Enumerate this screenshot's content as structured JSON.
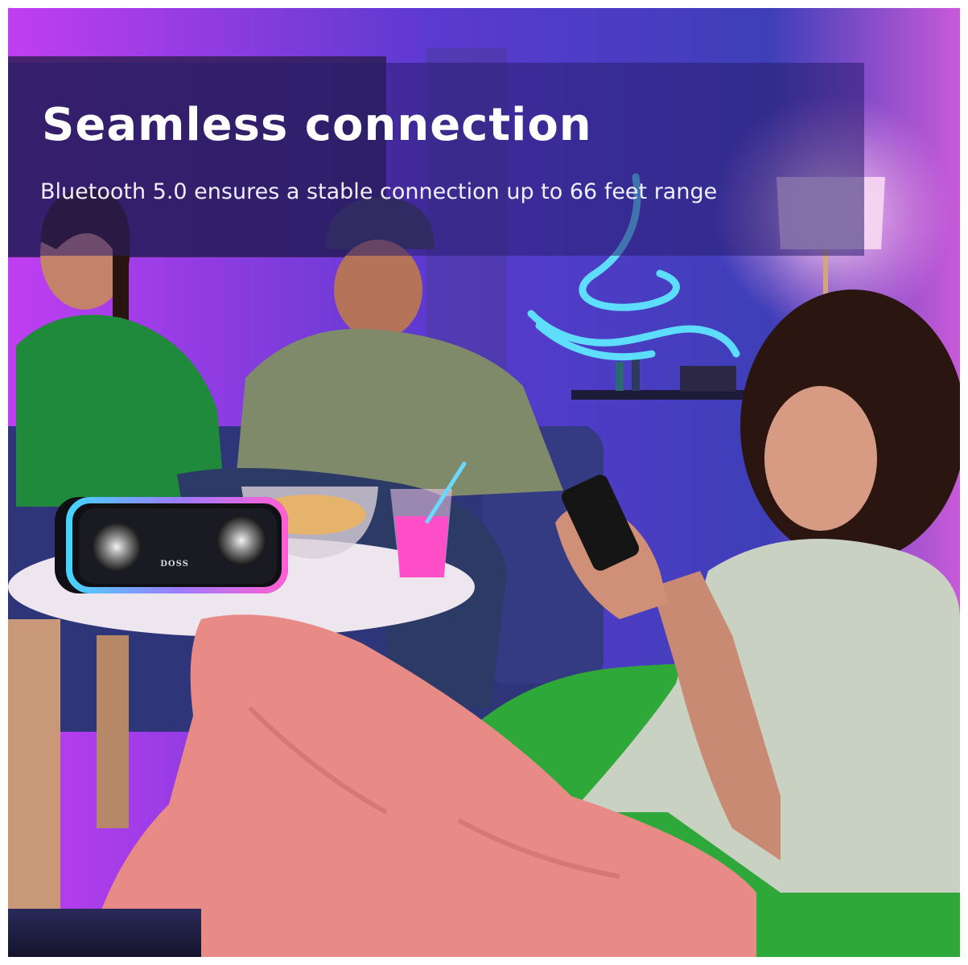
{
  "banner": {
    "headline": "Seamless connection",
    "subline": "Bluetooth 5.0 ensures a stable connection up to 66 feet range"
  },
  "speaker": {
    "brand": "DOSS"
  },
  "colors": {
    "wall_purple": "#b43cf0",
    "wall_blue": "#4a3fc8",
    "neon_cyan": "#3fd2ff",
    "bean_bag_green": "#2fa83a",
    "pants_pink": "#e88a86",
    "banner_overlay": "#281e6e"
  },
  "icons": [
    "neon-sign-icon",
    "speaker-led-ring"
  ]
}
